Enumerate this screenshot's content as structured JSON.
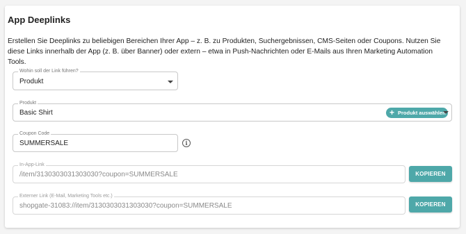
{
  "section": {
    "title": "App Deeplinks",
    "description": "Erstellen Sie Deeplinks zu beliebigen Bereichen Ihrer App – z. B. zu Produkten, Suchergebnissen, CMS-Seiten oder Coupons. Nutzen Sie diese Links innerhalb der App (z. B. über Banner) oder extern – etwa in Push-Nachrichten oder E-Mails aus Ihren Marketing Automation Tools."
  },
  "link_target": {
    "label": "Wohin soll der Link führen?",
    "value": "Produkt"
  },
  "product": {
    "label": "Produkt",
    "value": "Basic Shirt",
    "select_button": "Produkt auswählen",
    "select_icon": "plus-icon"
  },
  "coupon": {
    "label": "Coupon Code",
    "value": "SUMMERSALE",
    "info_icon": "info-icon"
  },
  "in_app_link": {
    "label": "In-App-Link",
    "value": "/item/3130303031303030?coupon=SUMMERSALE",
    "copy_button": "KOPIEREN"
  },
  "external_link": {
    "label": "Externer Link (E-Mail, Marketing Tools etc.)",
    "value": "shopgate-31083://item/3130303031303030?coupon=SUMMERSALE",
    "copy_button": "KOPIEREN"
  },
  "colors": {
    "accent": "#4ea8a9",
    "background": "#f4f4f4",
    "card": "#ffffff",
    "border": "#c8c8c8"
  }
}
